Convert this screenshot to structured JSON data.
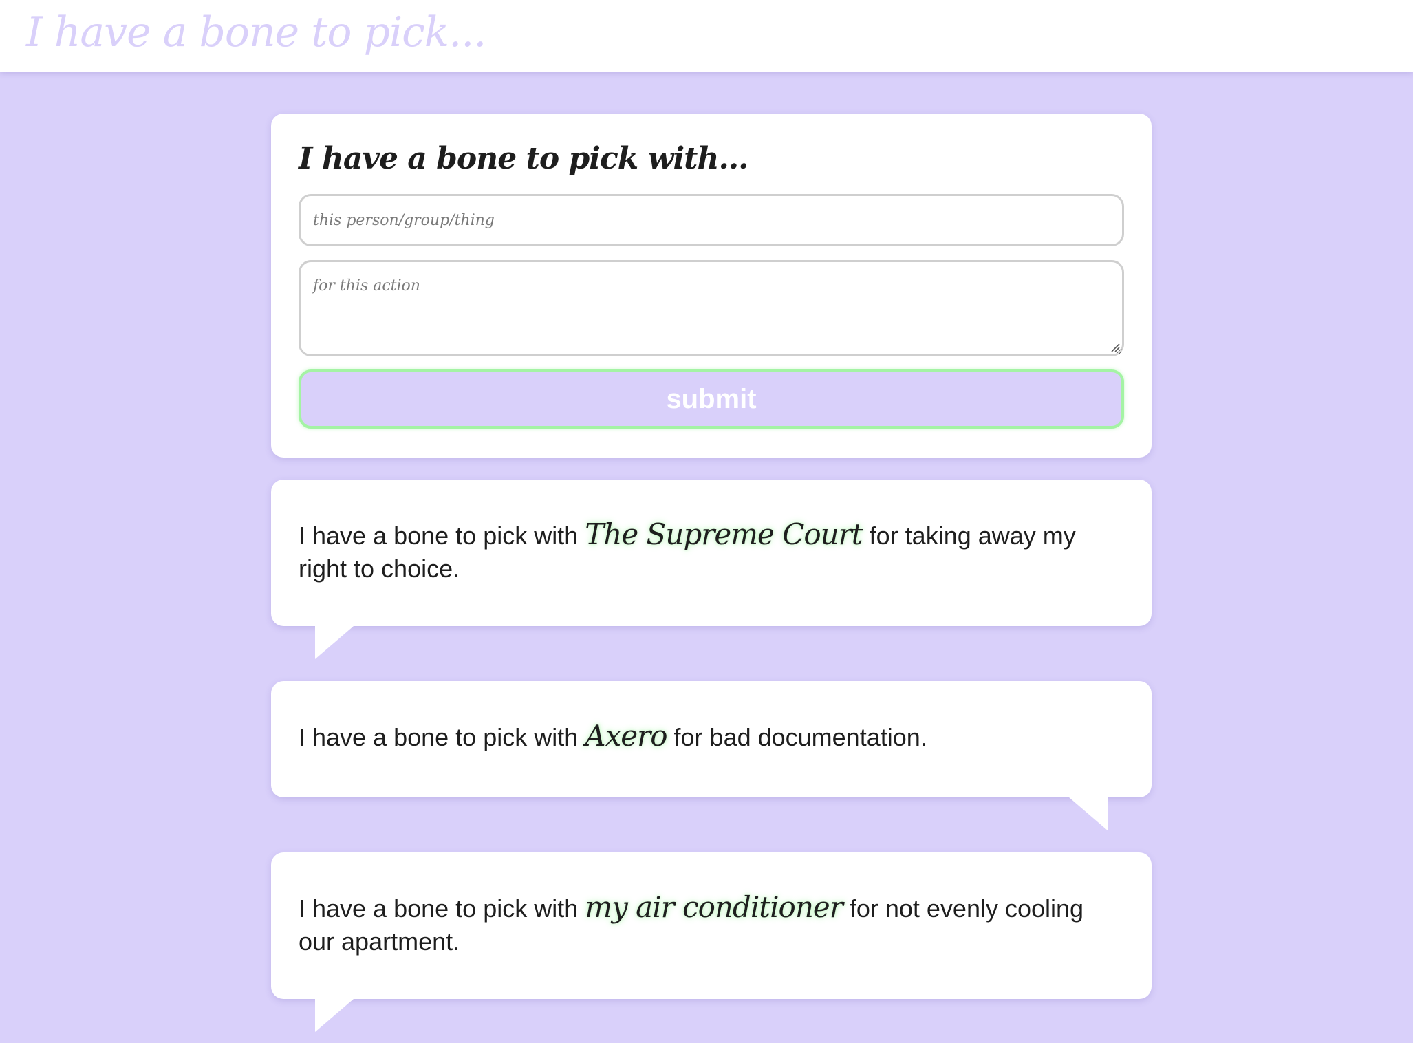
{
  "header": {
    "site_title": "I have a bone to pick..."
  },
  "form": {
    "heading": "I have a bone to pick with...",
    "person_placeholder": "this person/group/thing",
    "action_placeholder": "for this action",
    "submit_label": "submit"
  },
  "bones": [
    {
      "prefix": "I have a bone to pick with",
      "target": "The Supreme Court",
      "reason": "for taking away my right to choice.",
      "tail": "left"
    },
    {
      "prefix": "I have a bone to pick with",
      "target": "Axero",
      "reason": "for bad documentation.",
      "tail": "right"
    },
    {
      "prefix": "I have a bone to pick with",
      "target": "my air conditioner",
      "reason": "for not evenly cooling our apartment.",
      "tail": "left"
    }
  ],
  "colors": {
    "background": "#d9d0fa",
    "accent_green": "#a4f3a4",
    "card": "#ffffff",
    "text": "#1e1e1e"
  }
}
